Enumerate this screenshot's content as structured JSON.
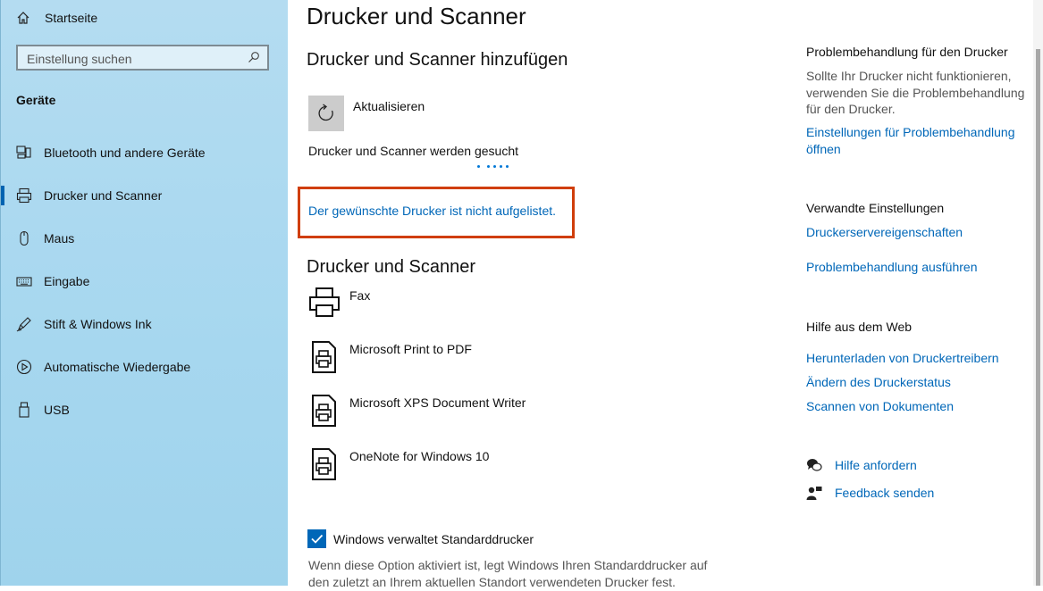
{
  "sidebar": {
    "home_label": "Startseite",
    "search_placeholder": "Einstellung suchen",
    "category": "Geräte",
    "items": [
      {
        "label": "Bluetooth und andere Geräte",
        "icon": "bluetooth-devices-icon"
      },
      {
        "label": "Drucker und Scanner",
        "icon": "printer-icon",
        "active": true
      },
      {
        "label": "Maus",
        "icon": "mouse-icon"
      },
      {
        "label": "Eingabe",
        "icon": "keyboard-icon"
      },
      {
        "label": "Stift & Windows Ink",
        "icon": "pen-icon"
      },
      {
        "label": "Automatische Wiedergabe",
        "icon": "autoplay-icon"
      },
      {
        "label": "USB",
        "icon": "usb-icon"
      }
    ]
  },
  "main": {
    "title": "Drucker und Scanner",
    "add_section_title": "Drucker und Scanner hinzufügen",
    "refresh_label": "Aktualisieren",
    "searching_text": "Drucker und Scanner werden gesucht",
    "not_listed_link": "Der gewünschte Drucker ist nicht aufgelistet.",
    "list_section_title": "Drucker und Scanner",
    "printers": [
      {
        "name": "Fax",
        "icon": "fax-icon"
      },
      {
        "name": "Microsoft Print to PDF",
        "icon": "document-printer-icon"
      },
      {
        "name": "Microsoft XPS Document Writer",
        "icon": "document-printer-icon"
      },
      {
        "name": "OneNote for Windows 10",
        "icon": "document-printer-icon"
      }
    ],
    "default_printer_checkbox": "Windows verwaltet Standarddrucker",
    "default_printer_checked": true,
    "default_printer_desc": "Wenn diese Option aktiviert ist, legt Windows Ihren Standarddrucker auf den zuletzt an Ihrem aktuellen Standort verwendeten Drucker fest."
  },
  "right": {
    "troubleshoot_title": "Problembehandlung für den Drucker",
    "troubleshoot_desc": "Sollte Ihr Drucker nicht funktionieren, verwenden Sie die Problembehandlung für den Drucker.",
    "troubleshoot_link": "Einstellungen für Problembehandlung öffnen",
    "related_title": "Verwandte Einstellungen",
    "related_links": [
      "Druckerservereigenschaften",
      "Problembehandlung ausführen"
    ],
    "web_help_title": "Hilfe aus dem Web",
    "web_links": [
      "Herunterladen von Druckertreibern",
      "Ändern des Druckerstatus",
      "Scannen von Dokumenten"
    ],
    "get_help": "Hilfe anfordern",
    "feedback": "Feedback senden"
  },
  "colors": {
    "accent": "#0067b8",
    "highlight_border": "#d03e0a",
    "sidebar_bg": "#a6d7ef"
  }
}
